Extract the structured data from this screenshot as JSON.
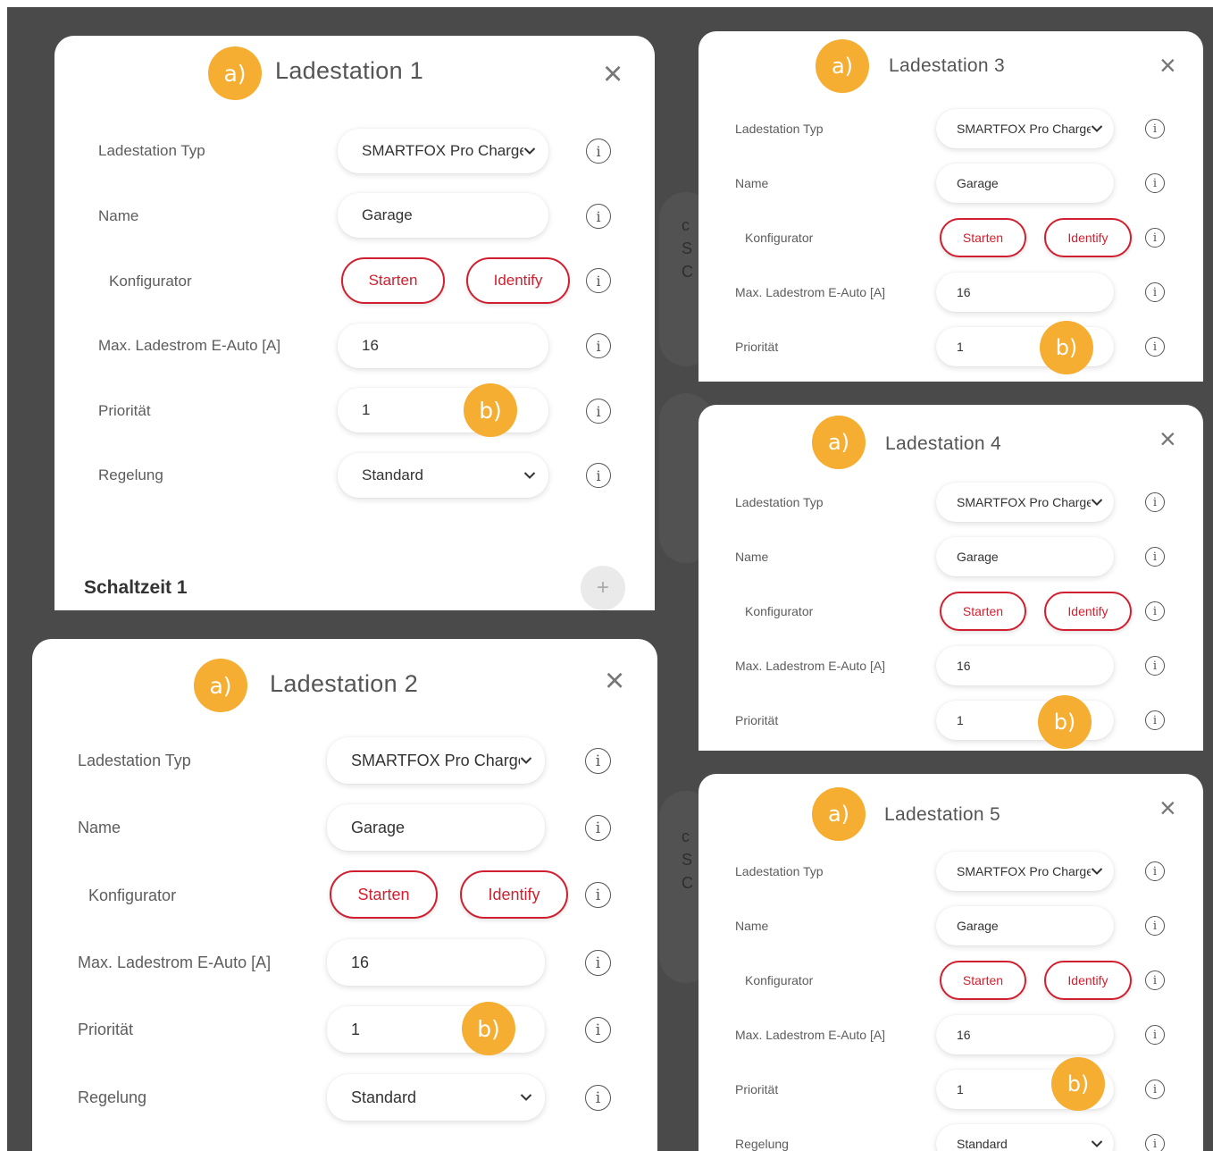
{
  "screen": {
    "background": "#4a4a4a",
    "accent": "#d0202f",
    "badge_color": "#f5ad32"
  },
  "markers": {
    "a": "a)",
    "b": "b)"
  },
  "common": {
    "close_glyph": "×",
    "info_glyph": "i",
    "chevron_icon": "chevron-down-icon",
    "labels": {
      "type": "Ladestation Typ",
      "name": "Name",
      "configurator": "Konfigurator",
      "max_current": "Max. Ladestrom E-Auto [A]",
      "priority": "Priorität",
      "control": "Regelung"
    },
    "values": {
      "type": "SMARTFOX Pro Charger",
      "name": "Garage",
      "max_current": "16",
      "priority": "1",
      "control": "Standard"
    },
    "buttons": {
      "start": "Starten",
      "identify": "Identify"
    }
  },
  "panels": [
    {
      "title": "Ladestation 1"
    },
    {
      "title": "Ladestation 2"
    },
    {
      "title": "Ladestation 3"
    },
    {
      "title": "Ladestation 4"
    },
    {
      "title": "Ladestation 5"
    }
  ],
  "schedule": {
    "title": "Schaltzeit 1",
    "add_glyph": "+"
  },
  "background_fragments": [
    "c",
    "S",
    "C"
  ]
}
